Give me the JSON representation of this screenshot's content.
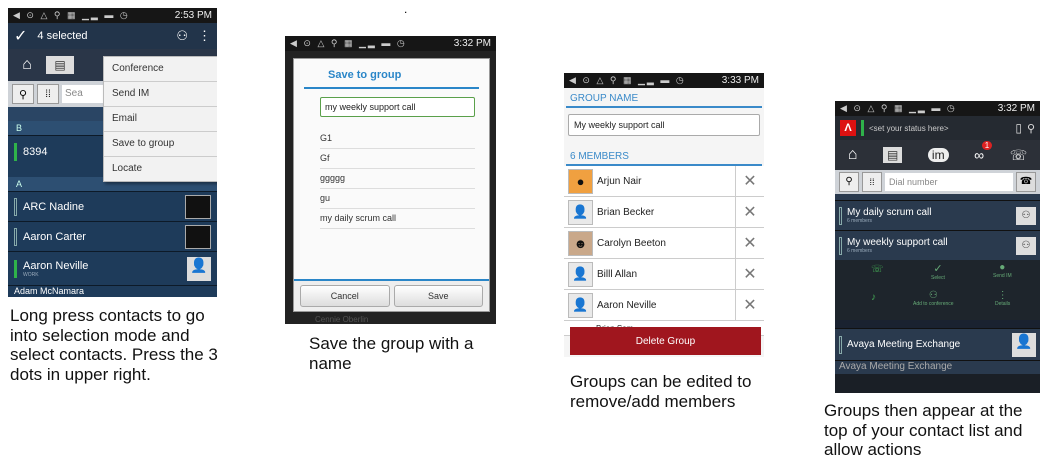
{
  "stray_mark": ".",
  "captions": {
    "c1": "Long press contacts to go into selection mode and select contacts. Press the 3 dots in upper right.",
    "c2": "Save the group with a name",
    "c3": "Groups can be edited to remove/add members",
    "c4": "Groups then appear at the top of your contact list and allow actions"
  },
  "screen1": {
    "time": "2:53 PM",
    "selected_label": "4 selected",
    "search_placeholder": "Sea",
    "menu": [
      "Conference",
      "Send IM",
      "Email",
      "Save to group",
      "Locate"
    ],
    "section_b": "B",
    "row_b_name": "8394",
    "section_a": "A",
    "contacts": [
      {
        "name": "ARC Nadine",
        "sub": ""
      },
      {
        "name": "Aaron Carter",
        "sub": ""
      },
      {
        "name": "Aaron Neville",
        "sub": "WORK"
      }
    ],
    "partial_row": "Adam McNamara"
  },
  "screen2": {
    "time": "3:32 PM",
    "dialog_title": "Save to group",
    "input_value": "my weekly support call",
    "groups": [
      "G1",
      "Gf",
      "ggggg",
      "gu",
      "my daily scrum call"
    ],
    "cancel_label": "Cancel",
    "save_label": "Save",
    "behind_text": "Cennie Oberlin"
  },
  "screen3": {
    "time": "3:33 PM",
    "group_name_header": "GROUP NAME",
    "group_name_value": "My weekly support call",
    "members_header": "6 MEMBERS",
    "members": [
      "Arjun Nair",
      "Brian Becker",
      "Carolyn Beeton",
      "Billl Allan",
      "Aaron Neville",
      "Brian Sam"
    ],
    "delete_label": "Delete Group"
  },
  "screen4": {
    "time": "3:32 PM",
    "status_text": "<set your status here>",
    "dial_placeholder": "Dial number",
    "voicemail_badge": "1",
    "groups": [
      {
        "name": "My daily scrum call",
        "sub": "6 members"
      },
      {
        "name": "My weekly support call",
        "sub": "6 members"
      }
    ],
    "actions": {
      "select": "Select",
      "send_im": "Send IM",
      "add_conf": "Add to conference",
      "details": "Details"
    },
    "contacts": [
      "Avaya Meeting Exchange",
      "Avaya Meeting Exchange"
    ]
  },
  "colors": {
    "accent_blue": "#2a86c8",
    "delete_red": "#a0161e",
    "presence_green": "#2fb24a"
  }
}
